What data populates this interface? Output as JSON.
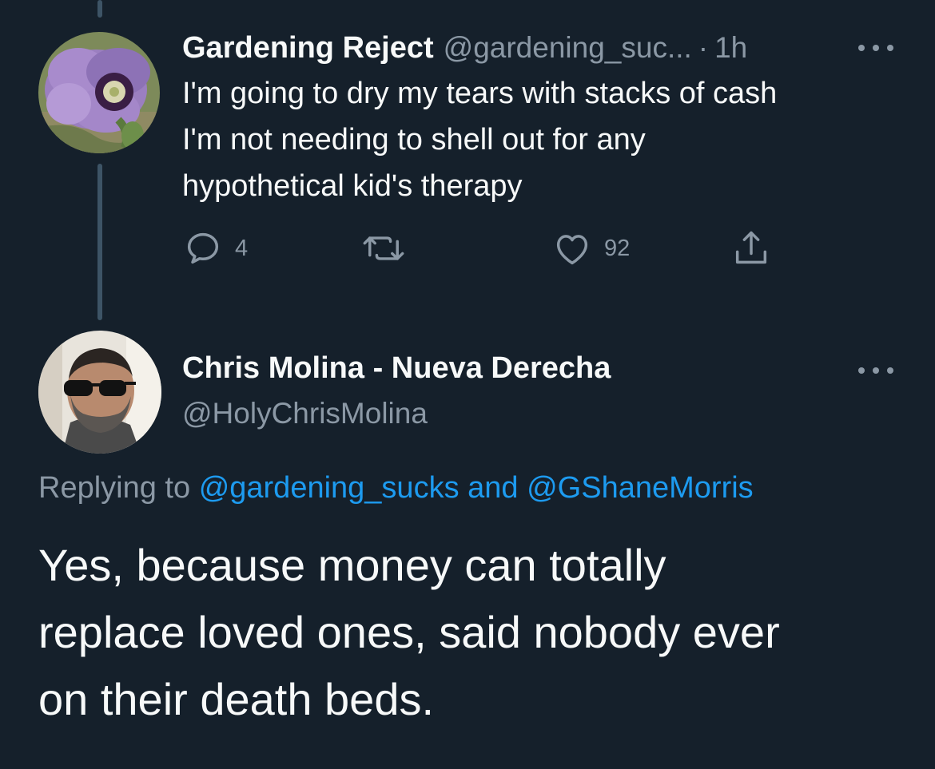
{
  "tweet1": {
    "display_name": "Gardening Reject",
    "handle": "@gardening_suc...",
    "separator": "·",
    "time": "1h",
    "text_lines": [
      "I'm going to dry my tears with stacks of cash",
      "I'm not needing to shell out for any",
      "hypothetical kid's therapy"
    ],
    "avatar_icon": "poppy-flower-avatar",
    "actions": {
      "reply_icon": "reply-icon",
      "reply_count": "4",
      "retweet_icon": "retweet-icon",
      "like_icon": "heart-icon",
      "like_count": "92",
      "share_icon": "share-icon"
    },
    "more_icon": "more-options-icon"
  },
  "tweet2": {
    "display_name": "Chris Molina - Nueva Derecha",
    "handle": "@HolyChrisMolina",
    "avatar_icon": "man-sunglasses-avatar",
    "more_icon": "more-options-icon",
    "replying_prefix": "Replying to",
    "replying_user1": "@gardening_sucks",
    "replying_and": "and",
    "replying_user2": "@GShaneMorris",
    "text_lines": [
      "Yes, because money can totally",
      "replace loved ones, said nobody ever",
      "on their death beds."
    ]
  },
  "colors": {
    "background": "#15202b",
    "primary_text": "#f7f9f9",
    "secondary_text": "#8b98a5",
    "link": "#1d9bf0",
    "thread_line": "#3d5466"
  }
}
